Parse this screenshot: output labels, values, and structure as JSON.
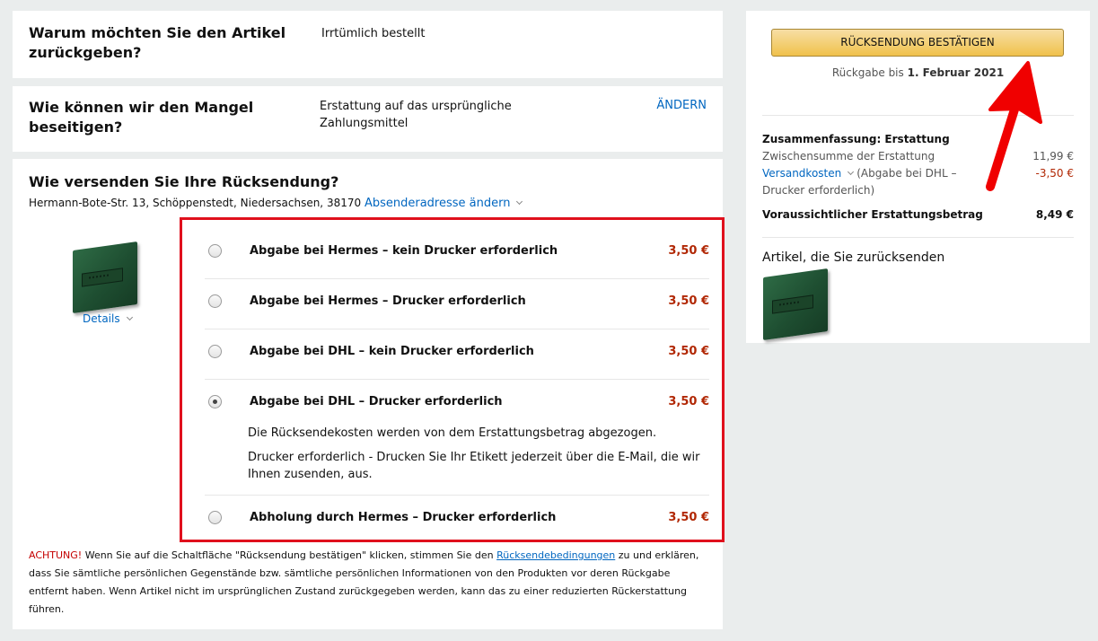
{
  "reason": {
    "question": "Warum möchten Sie den Artikel zurückgeben?",
    "answer": "Irrtümlich bestellt"
  },
  "remedy": {
    "question": "Wie können wir den Mangel beseitigen?",
    "answer": "Erstattung auf das ursprüngliche Zahlungsmittel",
    "change_link": "ÄNDERN"
  },
  "shipping": {
    "question": "Wie versenden Sie Ihre Rücksendung?",
    "address": "Hermann-Bote-Str. 13, Schöppenstedt, Niedersachsen, 38170",
    "change_address_link": "Absenderadresse ändern",
    "details_link": "Details",
    "options": [
      {
        "label": "Abgabe bei Hermes – kein Drucker erforderlich",
        "price": "3,50 €",
        "selected": false
      },
      {
        "label": "Abgabe bei Hermes – Drucker erforderlich",
        "price": "3,50 €",
        "selected": false
      },
      {
        "label": "Abgabe bei DHL – kein Drucker erforderlich",
        "price": "3,50 €",
        "selected": false
      },
      {
        "label": "Abgabe bei DHL – Drucker erforderlich",
        "price": "3,50 €",
        "selected": true
      },
      {
        "label": "Abholung durch Hermes – Drucker erforderlich",
        "price": "3,50 €",
        "selected": false
      }
    ],
    "selected_note_1": "Die Rücksendekosten werden von dem Erstattungsbetrag abgezogen.",
    "selected_note_2": "Drucker erforderlich - Drucken Sie Ihr Etikett jederzeit über die E-Mail, die wir Ihnen zusenden, aus."
  },
  "warning": {
    "prefix": "ACHTUNG!",
    "text_before_link": " Wenn Sie auf die Schaltfläche \"Rücksendung bestätigen\" klicken, stimmen Sie den ",
    "link": "Rücksendebedingungen",
    "text_after_link": " zu und erklären, dass Sie sämtliche persönlichen Gegenstände bzw. sämtliche persönlichen Informationen von den Produkten vor deren Rückgabe entfernt haben. Wenn Artikel nicht im ursprünglichen Zustand zurückgegeben werden, kann das zu einer reduzierten Rückerstattung führen."
  },
  "sidebar": {
    "confirm_button": "RÜCKSENDUNG BESTÄTIGEN",
    "deadline_prefix": "Rückgabe bis ",
    "deadline_date": "1. Februar 2021",
    "summary_title": "Zusammenfassung: Erstattung",
    "subtotal_label": "Zwischensumme der Erstattung",
    "subtotal_value": "11,99 €",
    "shipping_link": "Versandkosten",
    "shipping_desc": "(Abgabe bei DHL – Drucker erforderlich)",
    "shipping_value": "-3,50 €",
    "total_label": "Voraussichtlicher Erstattungsbetrag",
    "total_value": "8,49 €",
    "items_title": "Artikel, die Sie zurücksenden"
  },
  "colors": {
    "highlight_border": "#e0101d",
    "annotation_arrow": "#f00000",
    "price": "#b12704",
    "link": "#0066c0",
    "button": "#f0c14b"
  }
}
